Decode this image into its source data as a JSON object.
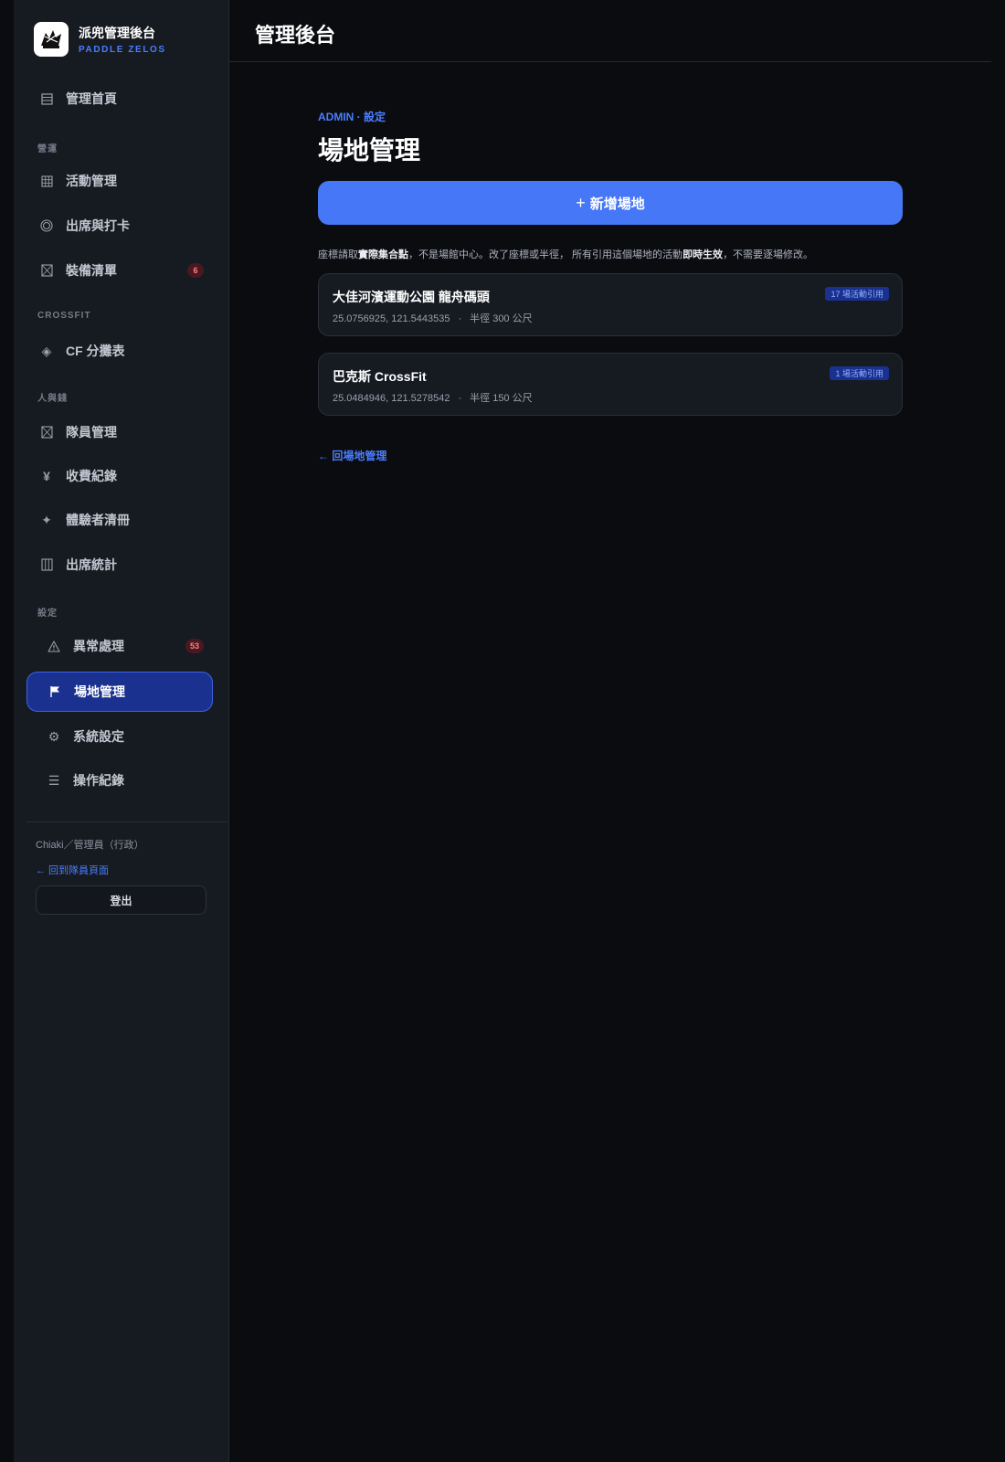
{
  "brand": {
    "name": "派兜管理後台",
    "subtitle": "PADDLE ZELOS"
  },
  "sidebar": {
    "home": "管理首頁",
    "sections": {
      "operations": "營運",
      "crossfit": "CROSSFIT",
      "people_money": "人與錢",
      "settings": "設定"
    },
    "items": {
      "activities": "活動管理",
      "attendance": "出席與打卡",
      "equipment": "裝備清單",
      "equipment_badge": "6",
      "cf_split": "CF 分攤表",
      "members": "隊員管理",
      "fees": "收費紀錄",
      "trial": "體驗者清冊",
      "stats": "出席統計",
      "exceptions": "異常處理",
      "exceptions_badge": "53",
      "venues": "場地管理",
      "system": "系統設定",
      "logs": "操作紀錄"
    },
    "user": "Chiaki／管理員（行政）",
    "back_member": "← 回到隊員頁面",
    "logout": "登出"
  },
  "header": {
    "title": "管理後台"
  },
  "main": {
    "eyebrow": "ADMIN · 設定",
    "title": "場地管理",
    "add_button": "新增場地",
    "hint": {
      "p1": "座標請取",
      "b1": "實際集合點",
      "p2": "，不是場館中心。改了座標或半徑， 所有引用這個場地的活動",
      "b2": "即時生效",
      "p3": "，不需要逐場修改。"
    },
    "venues": [
      {
        "name": "大佳河濱運動公園 龍舟碼頭",
        "coords": "25.0756925, 121.5443535",
        "radius": "半徑 300 公尺",
        "usage": "17 場活動引用"
      },
      {
        "name": "巴克斯 CrossFit",
        "coords": "25.0484946, 121.5278542",
        "radius": "半徑 150 公尺",
        "usage": "1 場活動引用"
      }
    ],
    "back_link": "← 回場地管理"
  },
  "colors": {
    "accent": "#4a7dff",
    "primary_button": "#4577f7",
    "active_nav_bg": "#1a3190",
    "danger_badge_bg": "#4a1820",
    "danger_badge_text": "#ff7f86",
    "background": "#0b0c10",
    "sidebar_bg": "#161a21"
  },
  "icons": {
    "home": "list-icon",
    "activities": "grid-icon",
    "attendance": "target-icon",
    "equipment": "hourglass-icon",
    "cf_split": "diamond-icon",
    "members": "hourglass-icon",
    "fees": "yen-icon",
    "trial": "sparkle-icon",
    "stats": "columns-icon",
    "exceptions": "warning-icon",
    "venues": "flag-icon",
    "system": "gear-icon",
    "logs": "menu-icon"
  }
}
